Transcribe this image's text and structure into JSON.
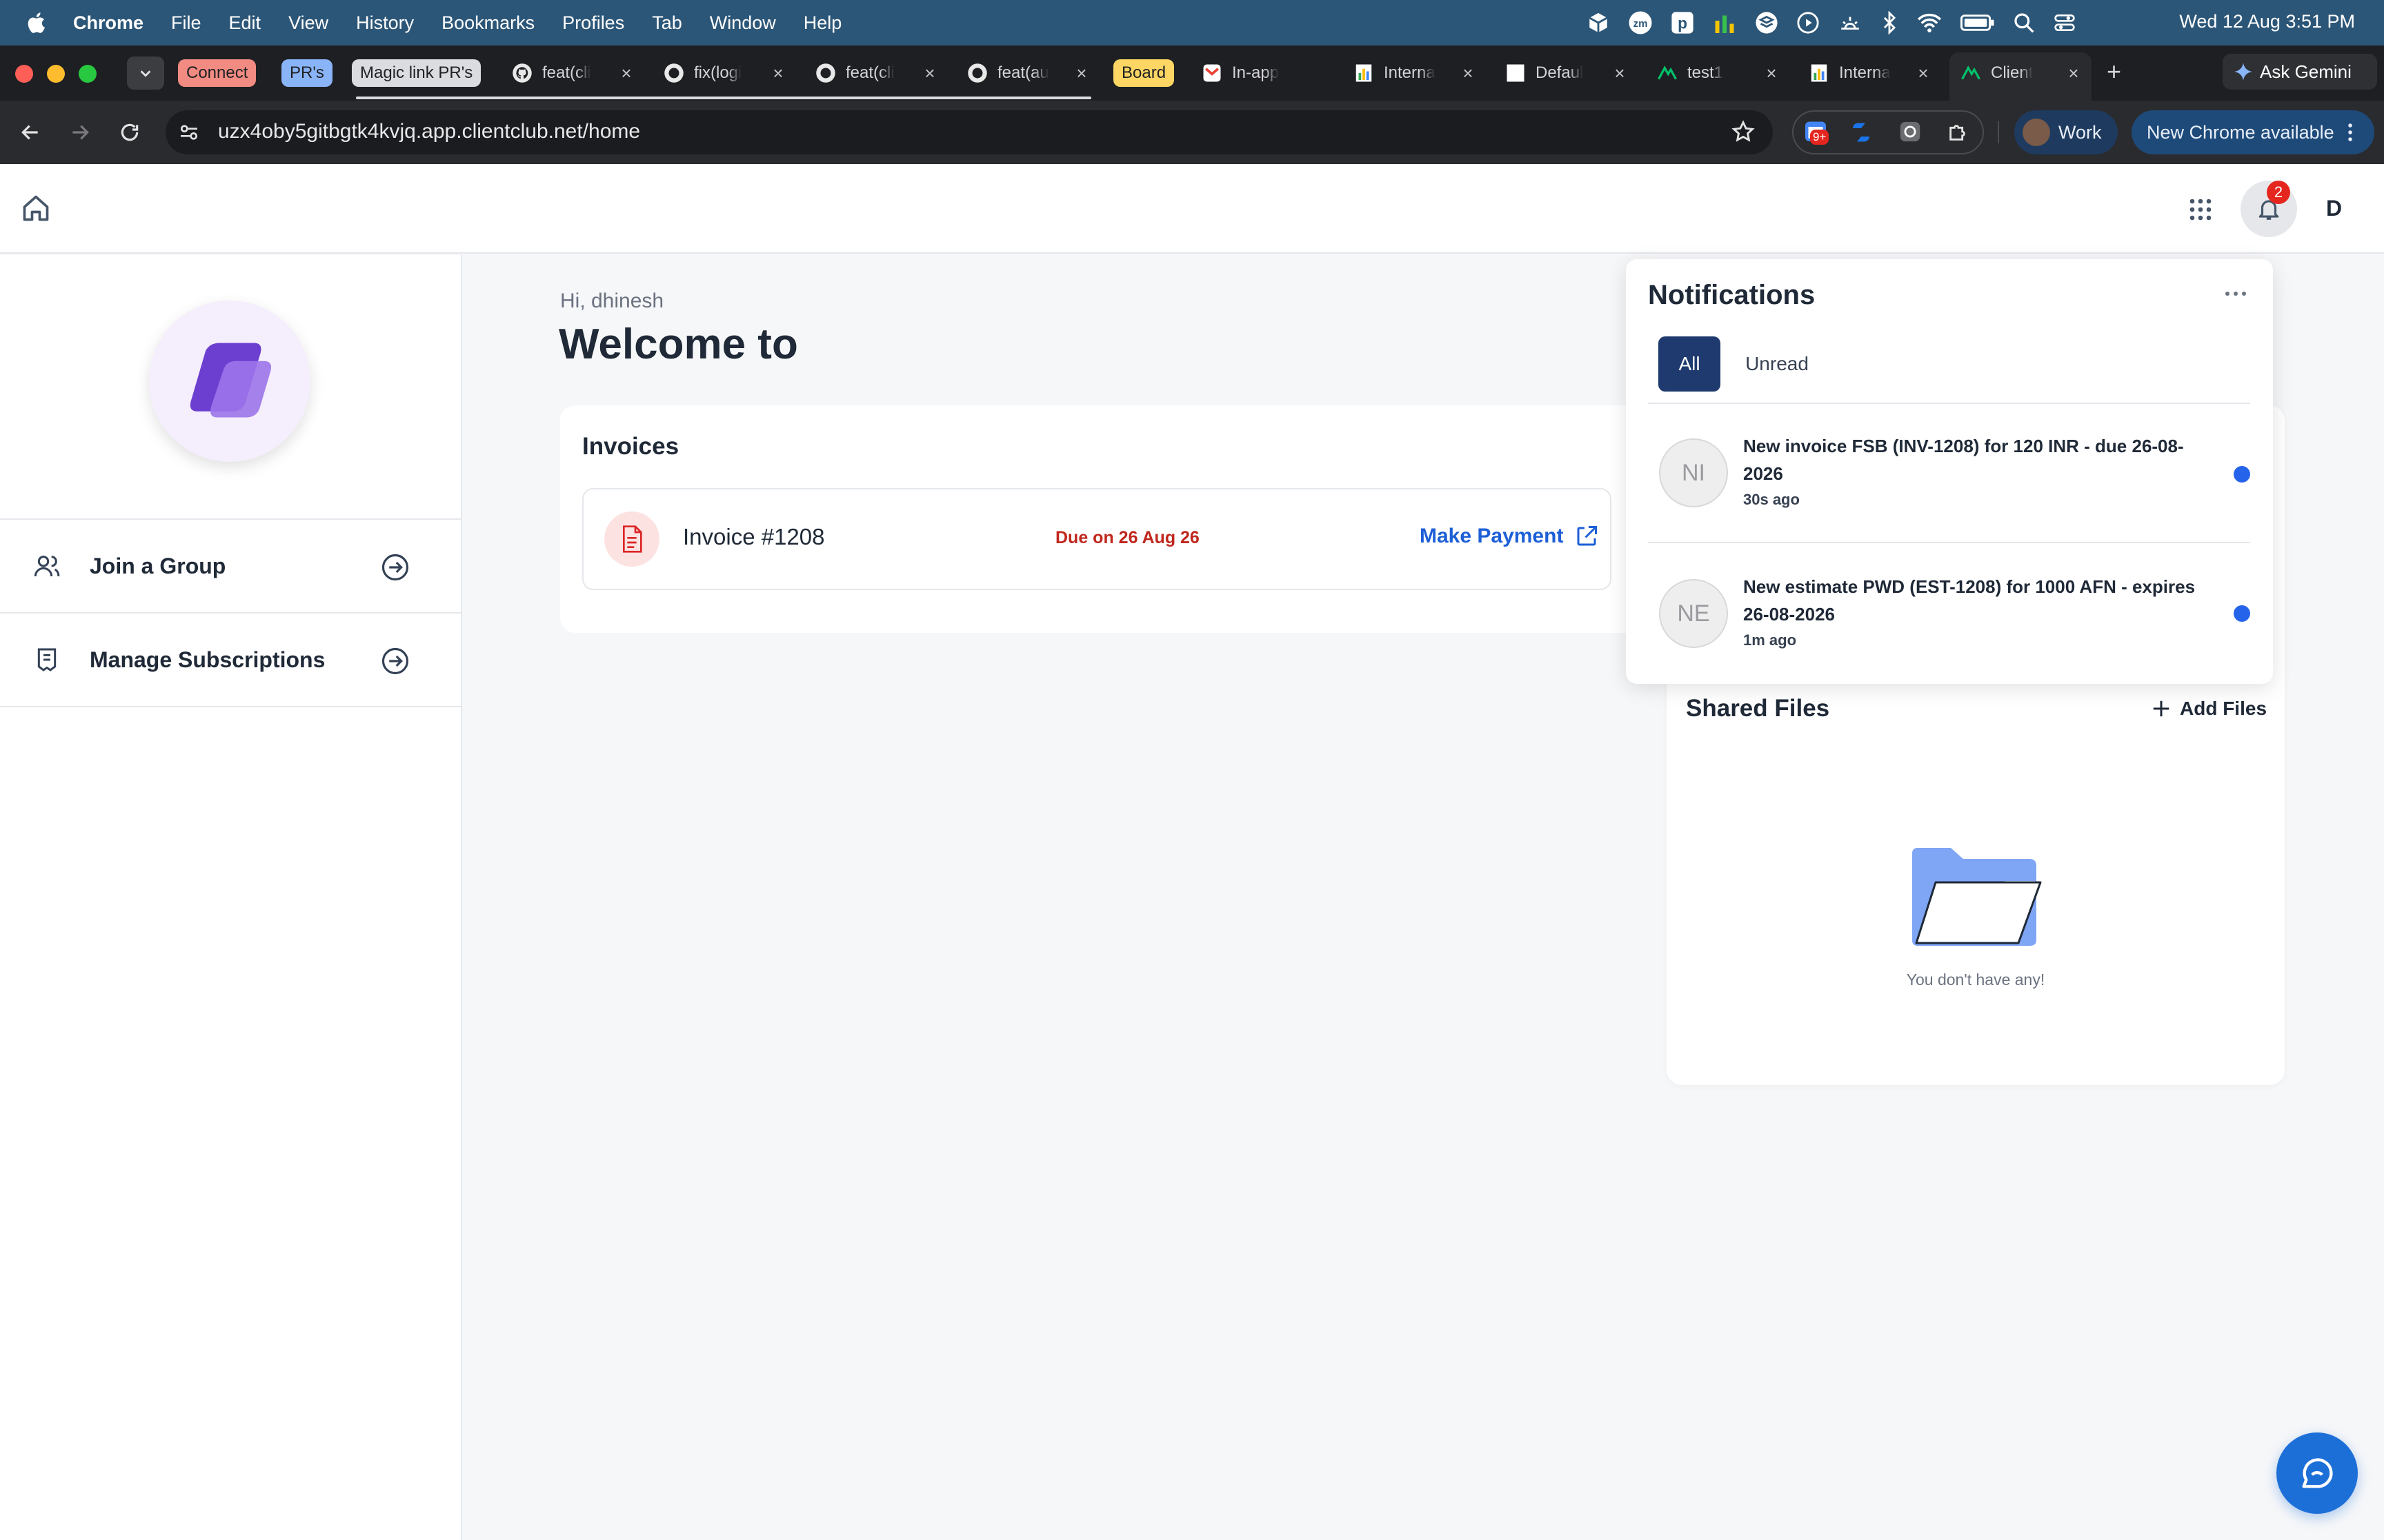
{
  "mac_menubar": {
    "app_name": "Chrome",
    "menus": [
      "File",
      "Edit",
      "View",
      "History",
      "Bookmarks",
      "Profiles",
      "Tab",
      "Window",
      "Help"
    ],
    "datetime": "Wed 12 Aug  3:51 PM"
  },
  "tab_groups": [
    {
      "label": "Connect",
      "color": "#f28b82",
      "text_color": "#202124"
    },
    {
      "label": "PR's",
      "color": "#8ab4f8",
      "text_color": "#202124"
    },
    {
      "label": "Magic link PR's",
      "color": "#dadce0",
      "text_color": "#202124"
    },
    {
      "label": "Board",
      "color": "#fdd663",
      "text_color": "#202124"
    }
  ],
  "tabs": [
    {
      "title": "feat(cli",
      "icon": "github-icon"
    },
    {
      "title": "fix(logi",
      "icon": "github-icon"
    },
    {
      "title": "feat(cli",
      "icon": "github-icon"
    },
    {
      "title": "feat(au",
      "icon": "github-icon"
    },
    {
      "title": "In-app",
      "icon": "gmail-icon"
    },
    {
      "title": "Interna",
      "icon": "sheets-icon"
    },
    {
      "title": "Defaul",
      "icon": "page-icon"
    },
    {
      "title": "test1",
      "icon": "clientclub-icon"
    },
    {
      "title": "Interna",
      "icon": "sheets-icon"
    },
    {
      "title": "Client",
      "icon": "clientclub-icon"
    }
  ],
  "ask_gemini_label": "Ask Gemini",
  "toolbar": {
    "url": "uzx4oby5gitbgtk4kvjq.app.clientclub.net/home",
    "extension_badge": "9+",
    "profile_label": "Work",
    "update_label": "New Chrome available"
  },
  "app_header": {
    "notification_count": "2",
    "user_initial": "D"
  },
  "sidebar": {
    "items": [
      {
        "label": "Join a Group",
        "icon": "users-icon"
      },
      {
        "label": "Manage Subscriptions",
        "icon": "receipt-icon"
      }
    ]
  },
  "main": {
    "greeting": "Hi, dhinesh",
    "welcome": "Welcome to",
    "invoices_title": "Invoices",
    "invoice": {
      "name": "Invoice #1208",
      "due": "Due on 26 Aug 26",
      "action": "Make Payment"
    }
  },
  "notifications": {
    "title": "Notifications",
    "tabs": [
      "All",
      "Unread"
    ],
    "active_tab": "All",
    "items": [
      {
        "initials": "NI",
        "line1": "New invoice FSB (INV-1208) for 120 INR - due 26-08-",
        "line2": "2026",
        "time": "30s ago",
        "unread": true
      },
      {
        "initials": "NE",
        "line1": "New estimate PWD (EST-1208) for 1000 AFN - expires",
        "line2": "26-08-2026",
        "time": "1m ago",
        "unread": true
      }
    ]
  },
  "shared_files": {
    "title": "Shared Files",
    "add_label": "Add Files",
    "empty_text": "You don't have any!"
  },
  "colors": {
    "accent": "#1d5fd6",
    "active_tab_bg": "#1e3a6e",
    "due_red": "#c0271d",
    "badge_red": "#e5261f"
  }
}
